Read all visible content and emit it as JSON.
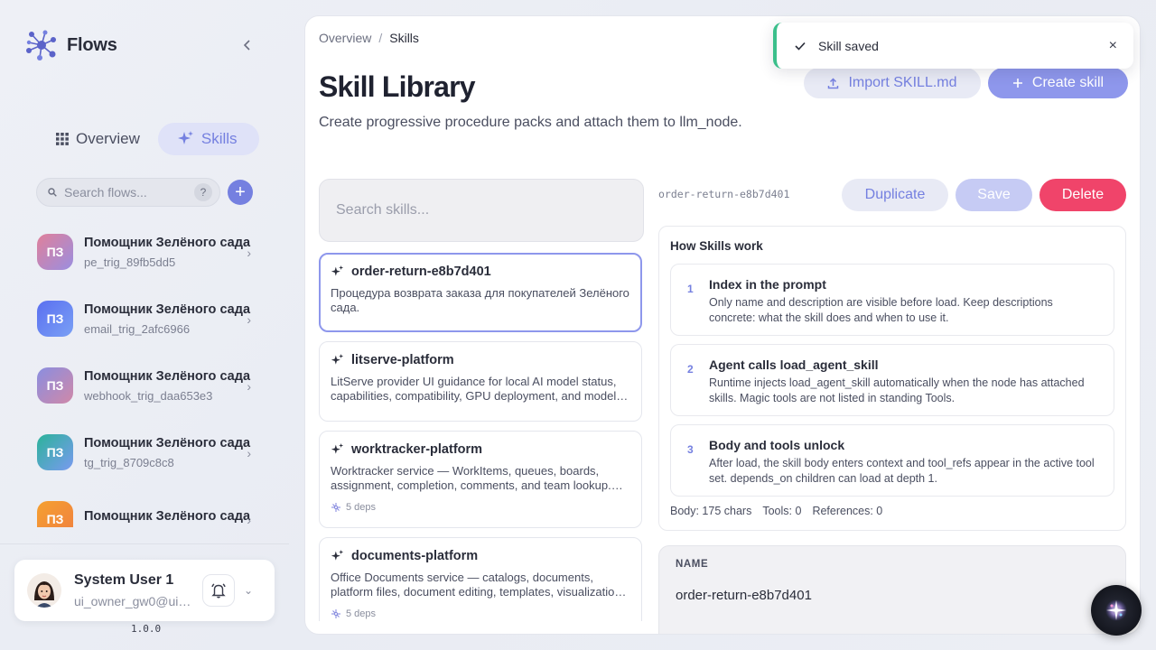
{
  "sidebar": {
    "brand": "Flows",
    "tabs": [
      {
        "label": "Overview",
        "icon": "grid-icon",
        "active": false
      },
      {
        "label": "Skills",
        "icon": "sparkle-icon",
        "active": true
      }
    ],
    "search_placeholder": "Search flows...",
    "help_label": "?",
    "add_label": "+",
    "flows": [
      {
        "initials": "ПЗ",
        "title": "Помощник Зелёного сада",
        "sub": "pe_trig_89fb5dd5",
        "color_a": "#e0809a",
        "color_b": "#9a8ee0"
      },
      {
        "initials": "ПЗ",
        "title": "Помощник Зелёного сада",
        "sub": "email_trig_2afc6966",
        "color_a": "#5a6ff0",
        "color_b": "#7aa0f5"
      },
      {
        "initials": "ПЗ",
        "title": "Помощник Зелёного сада",
        "sub": "webhook_trig_daa653e3",
        "color_a": "#8a8ee0",
        "color_b": "#d088a8"
      },
      {
        "initials": "ПЗ",
        "title": "Помощник Зелёного сада",
        "sub": "tg_trig_8709c8c8",
        "color_a": "#2bb39a",
        "color_b": "#7a9af0"
      },
      {
        "initials": "ПЗ",
        "title": "Помощник Зелёного сада",
        "sub": "",
        "color_a": "#f5a030",
        "color_b": "#f08040"
      }
    ],
    "user": {
      "name": "System User 1",
      "email": "ui_owner_gw0@ui_..."
    },
    "version": "1.0.0"
  },
  "main": {
    "breadcrumb": {
      "root": "Overview",
      "sep": "/",
      "current": "Skills"
    },
    "title": "Skill Library",
    "subtitle": "Create progressive procedure packs and attach them to llm_node.",
    "import_label": "Import SKILL.md",
    "create_label": "Create skill",
    "skill_search_placeholder": "Search skills...",
    "skills": [
      {
        "name": "order-return-e8b7d401",
        "desc": "Процедура возврата заказа для покупателей Зелёного сада.",
        "deps": "",
        "selected": true
      },
      {
        "name": "litserve-platform",
        "desc": "LitServe provider UI guidance for local AI model status, capabilities, compatibility, GPU deployment, and model selection.",
        "deps": "",
        "selected": false
      },
      {
        "name": "worktracker-platform",
        "desc": "Worktracker service — WorkItems, queues, boards, assignment, completion, comments, and team lookup. Use for task management.",
        "deps": "5 deps",
        "selected": false
      },
      {
        "name": "documents-platform",
        "desc": "Office Documents service — catalogs, documents, platform files, document editing, templates, visualization and export.",
        "deps": "5 deps",
        "selected": false
      }
    ],
    "detail": {
      "id": "order-return-e8b7d401",
      "duplicate_label": "Duplicate",
      "save_label": "Save",
      "delete_label": "Delete",
      "how_title": "How Skills work",
      "steps": [
        {
          "num": "1",
          "title": "Index in the prompt",
          "desc": "Only name and description are visible before load. Keep descriptions concrete: what the skill does and when to use it."
        },
        {
          "num": "2",
          "title": "Agent calls load_agent_skill",
          "desc": "Runtime injects load_agent_skill automatically when the node has attached skills. Magic tools are not listed in standing Tools."
        },
        {
          "num": "3",
          "title": "Body and tools unlock",
          "desc": "After load, the skill body enters context and tool_refs appear in the active tool set. depends_on children can load at depth 1."
        }
      ],
      "stats": {
        "body": "Body: 175 chars",
        "tools": "Tools: 0",
        "refs": "References: 0"
      },
      "name_label": "NAME",
      "name_value": "order-return-e8b7d401"
    }
  },
  "toast": {
    "text": "Skill saved",
    "close": "×"
  },
  "colors": {
    "accent": "#7580e0",
    "danger": "#f0446a",
    "success": "#3bbf8b"
  }
}
